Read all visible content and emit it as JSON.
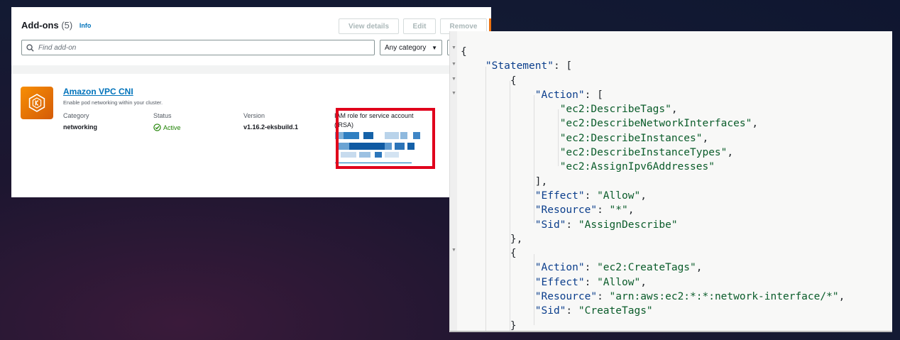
{
  "addons": {
    "title": "Add-ons",
    "count": "(5)",
    "info_link": "Info",
    "buttons": {
      "view_details": "View details",
      "edit": "Edit",
      "remove": "Remove"
    },
    "search": {
      "placeholder": "Find add-on"
    },
    "category_filter": {
      "selected": "Any category"
    },
    "card": {
      "name": "Amazon VPC CNI",
      "description": "Enable pod networking within your cluster.",
      "category_label": "Category",
      "category_value": "networking",
      "status_label": "Status",
      "status_value": "Active",
      "version_label": "Version",
      "version_value": "v1.16.2-eksbuild.1",
      "irsa_label": "IAM role for service account (IRSA)"
    }
  },
  "colors": {
    "highlight_box": "#e0001b",
    "link": "#0073bb",
    "status_ok": "#1d8102",
    "aws_orange": "#ec7211"
  },
  "policy_json": {
    "l1": "{",
    "statement_key": "\"Statement\"",
    "statement_open": ": [",
    "obj_open": "{",
    "action_key": "\"Action\"",
    "action_open": ": [",
    "actions": [
      "\"ec2:DescribeTags\"",
      "\"ec2:DescribeNetworkInterfaces\"",
      "\"ec2:DescribeInstances\"",
      "\"ec2:DescribeInstanceTypes\"",
      "\"ec2:AssignIpv6Addresses\""
    ],
    "action_close": "],",
    "effect_key": "\"Effect\"",
    "effect_value": "\"Allow\"",
    "resource_key": "\"Resource\"",
    "resource_value": "\"*\"",
    "sid_key": "\"Sid\"",
    "sid_value": "\"AssignDescribe\"",
    "obj_close_comma": "},",
    "obj2_open": "{",
    "action2_value": "\"ec2:CreateTags\"",
    "effect2_value": "\"Allow\"",
    "resource2_value": "\"arn:aws:ec2:*:*:network-interface/*\"",
    "sid2_value": "\"CreateTags\"",
    "obj2_close": "}"
  }
}
